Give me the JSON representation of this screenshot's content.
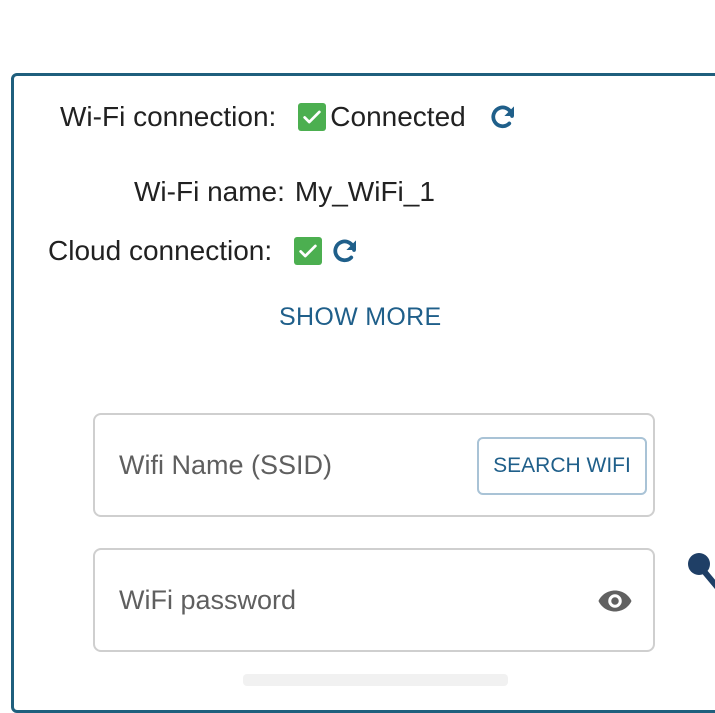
{
  "status": {
    "wifi_connection": {
      "label": "Wi-Fi connection:",
      "state": "Connected"
    },
    "wifi_name": {
      "label": "Wi-Fi name:",
      "value": "My_WiFi_1"
    },
    "cloud_connection": {
      "label": "Cloud connection:"
    }
  },
  "show_more_label": "SHOW MORE",
  "ssid_field": {
    "placeholder": "Wifi Name (SSID)",
    "search_label": "SEARCH WIFI"
  },
  "password_field": {
    "placeholder": "WiFi password"
  },
  "colors": {
    "accent": "#1f5f8a",
    "border": "#1f5f7d",
    "check_green": "#4caf50",
    "icon_gray": "#616161"
  },
  "icons": [
    "check-icon",
    "refresh-icon",
    "eye-icon"
  ]
}
